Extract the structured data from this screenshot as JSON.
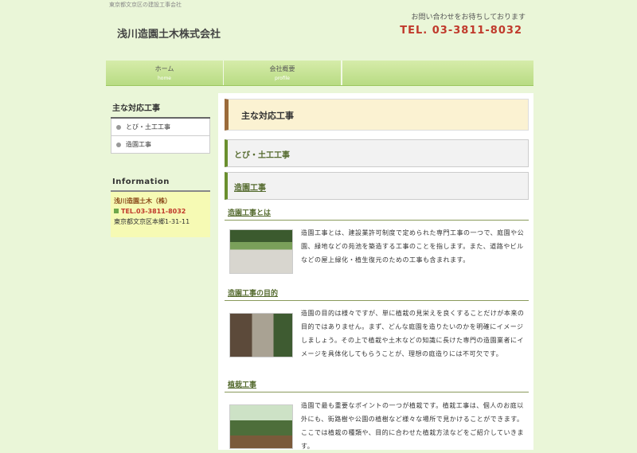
{
  "header": {
    "tagline": "東京都文京区の建設工事会社",
    "company": "浅川造園土木株式会社",
    "contact_note": "お問い合わせをお待ちしております",
    "tel": "TEL. 03-3811-8032"
  },
  "nav": [
    {
      "label": "ホーム",
      "sub": "home"
    },
    {
      "label": "会社概要",
      "sub": "profile"
    }
  ],
  "sidebar": {
    "title": "主な対応工事",
    "items": [
      {
        "label": "とび・土工工事"
      },
      {
        "label": "造園工事"
      }
    ],
    "info_title": "Information",
    "info_name": "浅川造園土木（株）",
    "info_tel": "TEL.03-3811-8032",
    "info_address": "東京都文京区本郷1-31-11"
  },
  "main": {
    "title": "主な対応工事",
    "sub1": "とび・土工工事",
    "sub2": "造園工事",
    "sections": [
      {
        "heading": "造園工事とは",
        "text": "造園工事とは、建設業許可制度で定められた専門工事の一つで、庭園や公園、緑地などの苑池を築造する工事のことを指します。また、道路やビルなどの屋上緑化・植生復元のための工事も含まれます。"
      },
      {
        "heading": "造園工事の目的",
        "text": "造園の目的は様々ですが、単に植栽の見栄えを良くすることだけが本来の目的ではありません。まず、どんな庭園を造りたいのかを明確にイメージしましょう。その上で植栽や土木などの知識に長けた専門の造園業者にイメージを具体化してもらうことが、理想の庭造りには不可欠です。"
      },
      {
        "heading": "植栽工事",
        "text": "造園で最も重要なポイントの一つが植栽です。植栽工事は、個人のお庭以外にも、街路樹や公園の植樹など様々な場所で見かけることができます。ここでは植栽の種類や、目的に合わせた植栽方法などをご紹介していきます。"
      }
    ]
  },
  "colors": {
    "accent_tel": "#c0392b",
    "nav_green": "#b8db83",
    "heading_green": "#556b2f"
  }
}
